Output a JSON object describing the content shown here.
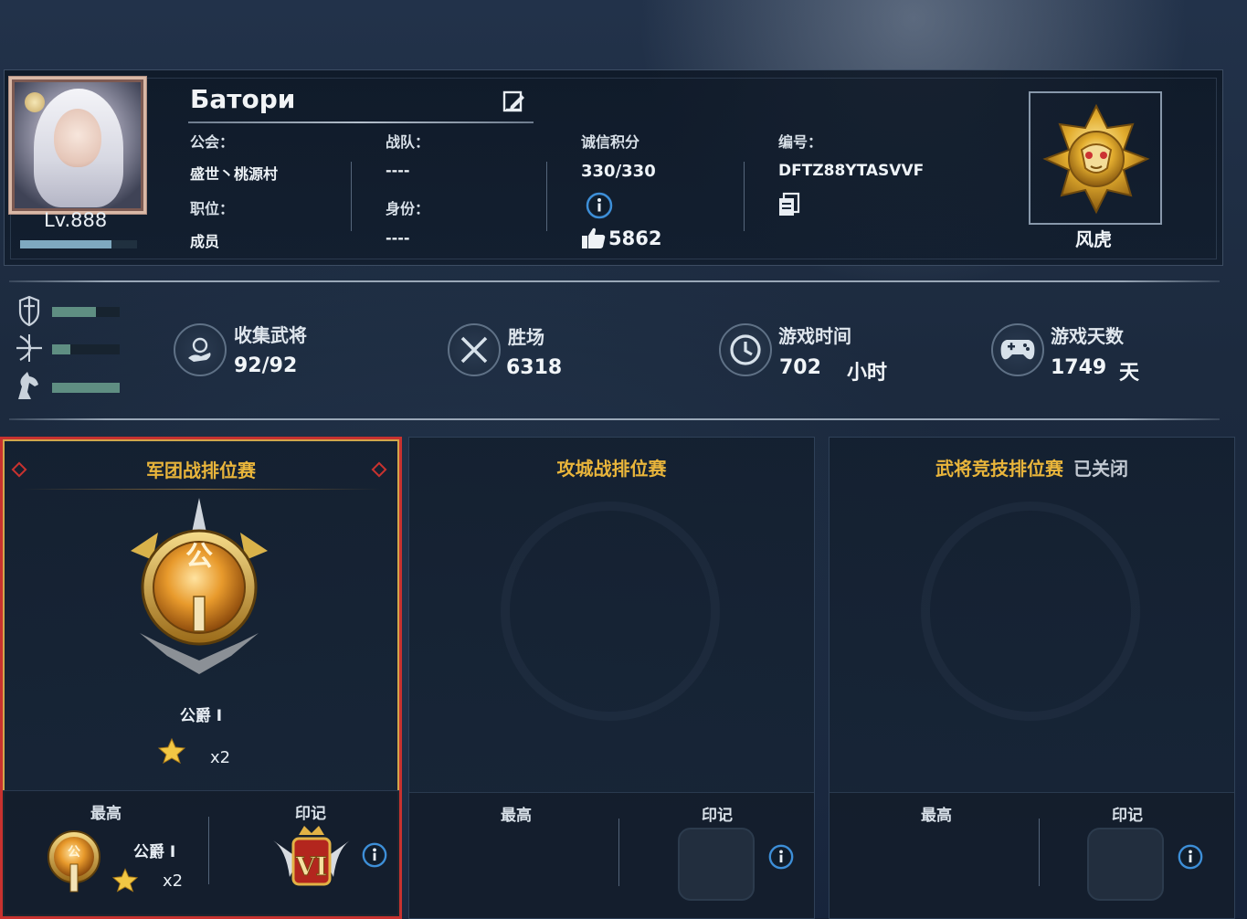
{
  "profile": {
    "name": "Батори",
    "level_label": "Lv.888",
    "xp_fraction": 0.78,
    "guild_label": "公会：",
    "guild_value": "盛世丶桃源村",
    "team_label": "战队：",
    "team_value": "----",
    "position_label": "职位：",
    "position_value": "成员",
    "identity_label": "身份：",
    "identity_value": "----",
    "integrity_label": "诚信积分",
    "integrity_value": "330/330",
    "likes": "5862",
    "uid_label": "编号：",
    "uid_value": "DFTZ88YTASVVF",
    "rank_title": "风虎"
  },
  "units": [
    {
      "name": "infantry",
      "fraction": 0.65
    },
    {
      "name": "archer",
      "fraction": 0.27
    },
    {
      "name": "cavalry",
      "fraction": 1.0
    }
  ],
  "stats": {
    "collect_label": "收集武将",
    "collect_value": "92/92",
    "wins_label": "胜场",
    "wins_value": "6318",
    "playtime_label": "游戏时间",
    "playtime_value": "702",
    "playtime_unit": "小时",
    "days_label": "游戏天数",
    "days_value": "1749",
    "days_unit": "天"
  },
  "cards": {
    "legion": {
      "title": "军团战排位赛",
      "rank_name": "公爵 Ⅰ",
      "star_count": "x2",
      "best_label": "最高",
      "best_rank": "公爵 Ⅰ",
      "best_stars": "x2",
      "mark_label": "印记",
      "mark_numeral": "VI"
    },
    "siege": {
      "title": "攻城战排位赛",
      "best_label": "最高",
      "mark_label": "印记"
    },
    "arena": {
      "title": "武将竞技排位赛",
      "status": "已关闭",
      "best_label": "最高",
      "mark_label": "印记"
    }
  },
  "colors": {
    "accent_gold": "#e9b53b",
    "active_border": "#c8322f",
    "unit_bar": "#5f8e82",
    "info_blue": "#3d8fd8"
  }
}
